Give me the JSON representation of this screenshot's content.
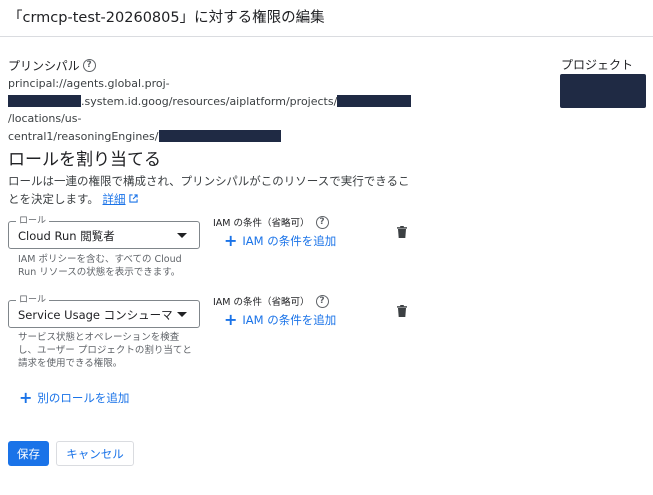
{
  "dialog": {
    "title": "「crmcp-test-20260805」に対する権限の編集"
  },
  "principal": {
    "label": "プリンシパル",
    "line1": "principal://agents.global.proj-",
    "line2_mid": ".system.id.goog/resources/aiplatform/projects/",
    "line2_end": "/locations/us-",
    "line3": "central1/reasoningEngines/"
  },
  "project": {
    "label": "プロジェクト"
  },
  "assign": {
    "title": "ロールを割り当てる",
    "description": "ロールは一連の権限で構成され、プリンシパルがこのリソースで実行できることを決定します。",
    "details_link": "詳細"
  },
  "roles": [
    {
      "legend": "ロール",
      "value": "Cloud Run 閲覧者",
      "helper": "IAM ポリシーを含む、すべての Cloud Run リソースの状態を表示できます。",
      "condition_label": "IAM の条件（省略可）",
      "add_condition": "IAM の条件を追加"
    },
    {
      "legend": "ロール",
      "value": "Service Usage コンシューマー",
      "helper": "サービス状態とオペレーションを検査し、ユーザー プロジェクトの割り当てと請求を使用できる権限。",
      "condition_label": "IAM の条件（省略可）",
      "add_condition": "IAM の条件を追加"
    }
  ],
  "add_role": "別のロールを追加",
  "buttons": {
    "save": "保存",
    "cancel": "キャンセル"
  },
  "colors": {
    "accent": "#1a73e8",
    "redaction": "#1f2a44"
  },
  "icons": {
    "help": "help-circle-icon",
    "trash": "trash-icon",
    "plus": "plus-icon",
    "external": "external-link-icon",
    "dropdown": "dropdown-arrow-icon"
  }
}
